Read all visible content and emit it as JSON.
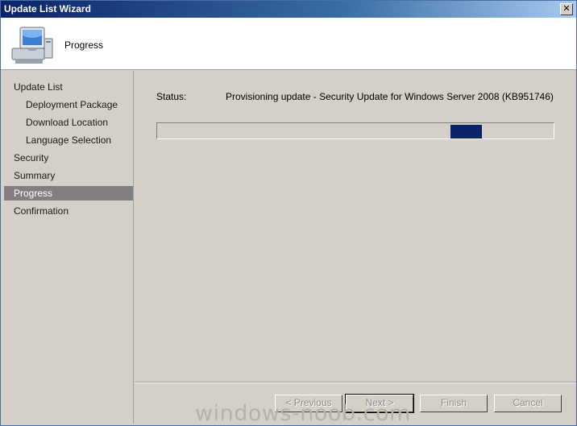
{
  "window": {
    "title": "Update List Wizard",
    "close_symbol": "✕"
  },
  "header": {
    "page_title": "Progress",
    "icon": "computer-icon"
  },
  "sidebar": {
    "items": [
      {
        "label": "Update List",
        "level": 0,
        "active": false
      },
      {
        "label": "Deployment Package",
        "level": 1,
        "active": false
      },
      {
        "label": "Download Location",
        "level": 1,
        "active": false
      },
      {
        "label": "Language Selection",
        "level": 1,
        "active": false
      },
      {
        "label": "Security",
        "level": 0,
        "active": false
      },
      {
        "label": "Summary",
        "level": 0,
        "active": false
      },
      {
        "label": "Progress",
        "level": 0,
        "active": true
      },
      {
        "label": "Confirmation",
        "level": 0,
        "active": false
      }
    ]
  },
  "main": {
    "status_label": "Status:",
    "status_text": "Provisioning update - Security Update for Windows Server 2008 (KB951746)",
    "progress": {
      "chunk_start_fraction": 0.74,
      "chunk_width_fraction": 0.08,
      "color": "#0a246a"
    }
  },
  "buttons": {
    "previous": "< Previous",
    "next": "Next >",
    "finish": "Finish",
    "cancel": "Cancel"
  },
  "watermark": "windows-noob.com"
}
